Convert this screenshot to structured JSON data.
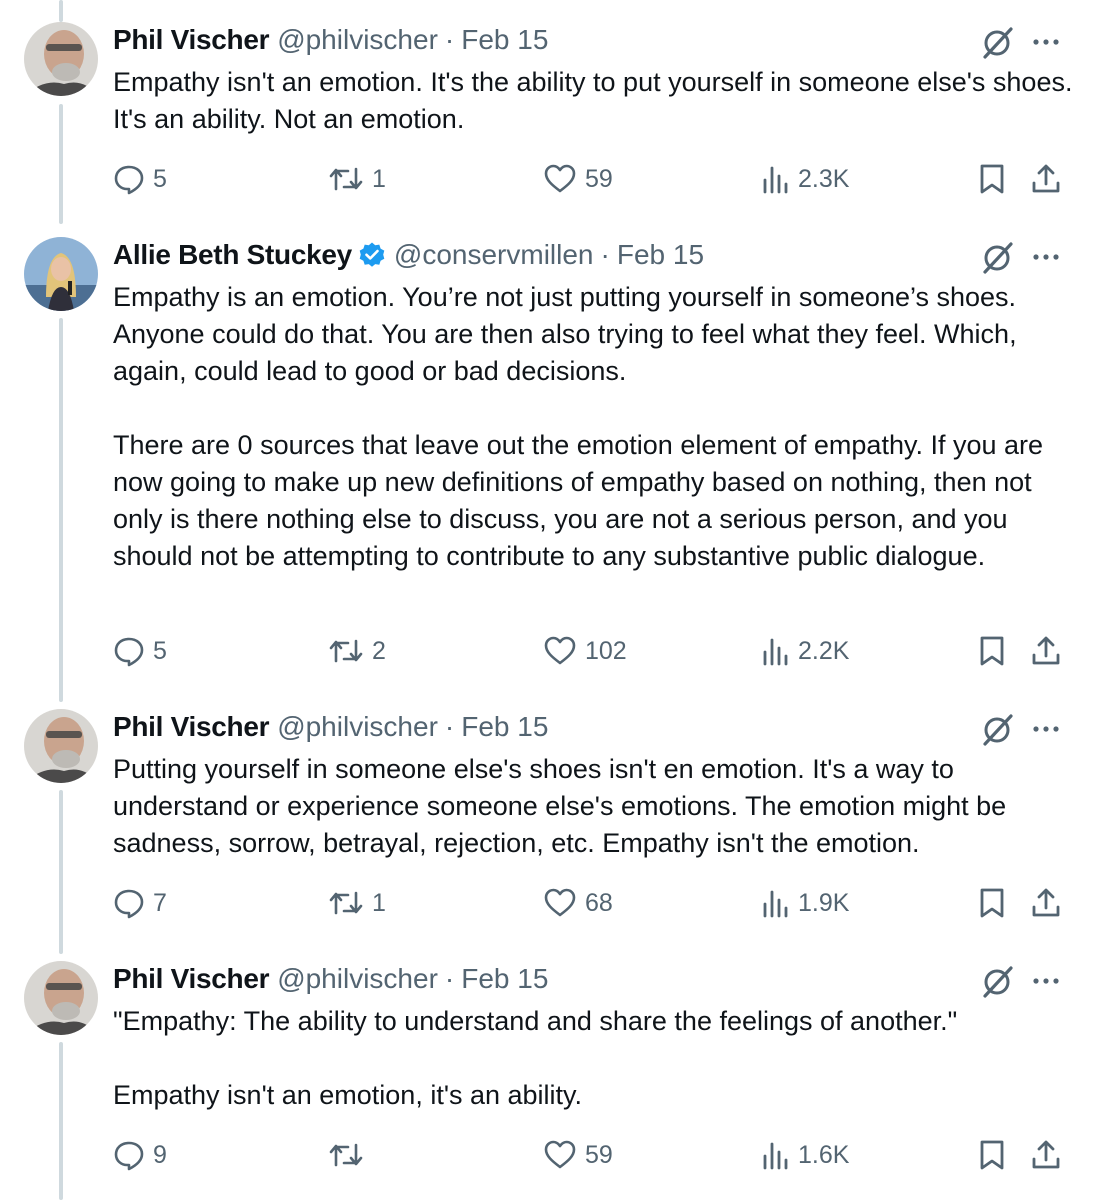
{
  "tweets": [
    {
      "author": "Phil Vischer",
      "handle": "@philvischer",
      "separator": "·",
      "date": "Feb 15",
      "verified": false,
      "text": "Empathy isn't an emotion.  It's the ability to put yourself in someone else's shoes.  It's an ability.  Not an emotion.",
      "replies": "5",
      "reposts": "1",
      "likes": "59",
      "views": "2.3K"
    },
    {
      "author": "Allie Beth Stuckey",
      "handle": "@conservmillen",
      "separator": "·",
      "date": "Feb 15",
      "verified": true,
      "text": "Empathy is an emotion. You’re not just putting yourself in someone’s shoes. Anyone could do that. You are then also  trying to feel what they feel. Which, again, could lead to good or bad decisions.\n\nThere are 0 sources that leave out the emotion element of empathy. If you are now going to make up new definitions of empathy based on nothing, then not only is there nothing else to discuss, you are not a serious person, and you should not be attempting to contribute to any substantive public dialogue.",
      "replies": "5",
      "reposts": "2",
      "likes": "102",
      "views": "2.2K"
    },
    {
      "author": "Phil Vischer",
      "handle": "@philvischer",
      "separator": "·",
      "date": "Feb 15",
      "verified": false,
      "text": "Putting yourself in someone else's shoes isn't en emotion.  It's a way to understand or experience someone else's emotions.  The emotion might be sadness, sorrow, betrayal, rejection, etc.  Empathy isn't the emotion.",
      "replies": "7",
      "reposts": "1",
      "likes": "68",
      "views": "1.9K"
    },
    {
      "author": "Phil Vischer",
      "handle": "@philvischer",
      "separator": "·",
      "date": "Feb 15",
      "verified": false,
      "text": "\"Empathy:  The ability to understand and share the feelings of another.\"\n\nEmpathy isn't an emotion, it's an ability.",
      "replies": "9",
      "reposts": "",
      "likes": "59",
      "views": "1.6K"
    }
  ],
  "icons": {
    "reply": "reply-icon",
    "repost": "repost-icon",
    "like": "heart-icon",
    "views": "views-icon",
    "bookmark": "bookmark-icon",
    "share": "share-icon",
    "grok": "grok-icon",
    "more": "more-icon",
    "verified": "verified-badge-icon"
  },
  "colors": {
    "text": "#0f1419",
    "secondary": "#536471",
    "thread_line": "#cfd9de",
    "verified": "#1d9bf0"
  }
}
